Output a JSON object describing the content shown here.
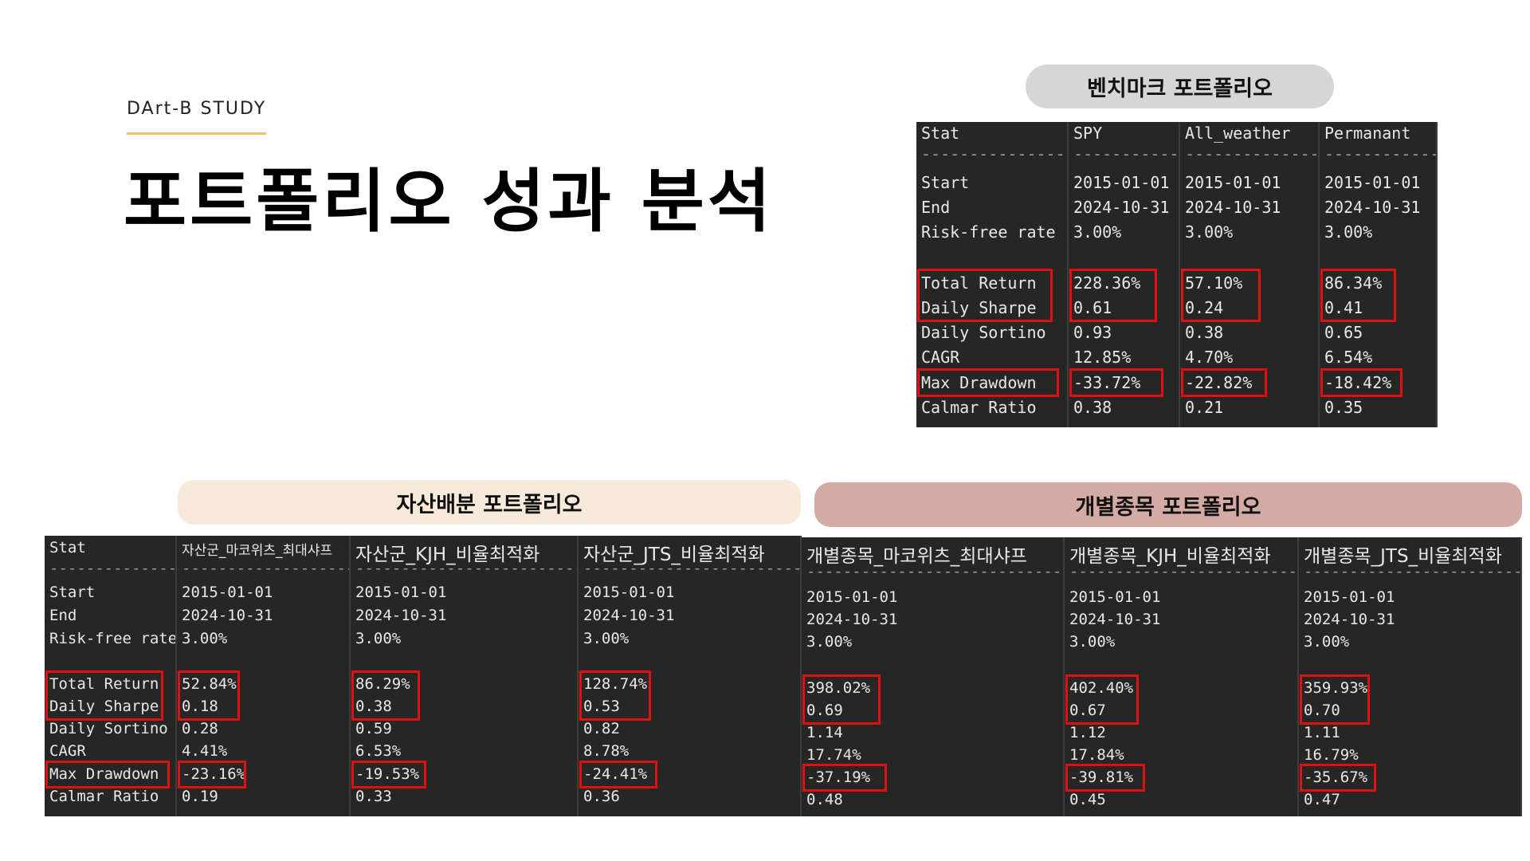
{
  "header": {
    "kicker": "DArt-B STUDY",
    "title": "포트폴리오 성과 분석"
  },
  "sections": {
    "benchmark": "벤치마크 포트폴리오",
    "asset_allocation": "자산배분 포트폴리오",
    "individual": "개별종목 포트폴리오"
  },
  "stat_labels": [
    "Start",
    "End",
    "Risk-free rate",
    "Total Return",
    "Daily Sharpe",
    "Daily Sortino",
    "CAGR",
    "Max Drawdown",
    "Calmar Ratio"
  ],
  "stat_header": "Stat",
  "benchmark_tables": [
    {
      "name": "SPY",
      "values": [
        "2015-01-01",
        "2024-10-31",
        "3.00%",
        "228.36%",
        "0.61",
        "0.93",
        "12.85%",
        "-33.72%",
        "0.38"
      ]
    },
    {
      "name": "All_weather",
      "values": [
        "2015-01-01",
        "2024-10-31",
        "3.00%",
        "57.10%",
        "0.24",
        "0.38",
        "4.70%",
        "-22.82%",
        "0.21"
      ]
    },
    {
      "name": "Permanant",
      "values": [
        "2015-01-01",
        "2024-10-31",
        "3.00%",
        "86.34%",
        "0.41",
        "0.65",
        "6.54%",
        "-18.42%",
        "0.35"
      ]
    }
  ],
  "asset_tables": [
    {
      "name": "자산군_마코위츠_최대샤프",
      "values": [
        "2015-01-01",
        "2024-10-31",
        "3.00%",
        "52.84%",
        "0.18",
        "0.28",
        "4.41%",
        "-23.16%",
        "0.19"
      ]
    },
    {
      "name": "자산군_KJH_비율최적화",
      "values": [
        "2015-01-01",
        "2024-10-31",
        "3.00%",
        "86.29%",
        "0.38",
        "0.59",
        "6.53%",
        "-19.53%",
        "0.33"
      ]
    },
    {
      "name": "자산군_JTS_비율최적화",
      "values": [
        "2015-01-01",
        "2024-10-31",
        "3.00%",
        "128.74%",
        "0.53",
        "0.82",
        "8.78%",
        "-24.41%",
        "0.36"
      ]
    }
  ],
  "individual_tables": [
    {
      "name": "개별종목_마코위츠_최대샤프",
      "values": [
        "2015-01-01",
        "2024-10-31",
        "3.00%",
        "398.02%",
        "0.69",
        "1.14",
        "17.74%",
        "-37.19%",
        "0.48"
      ]
    },
    {
      "name": "개별종목_KJH_비율최적화",
      "values": [
        "2015-01-01",
        "2024-10-31",
        "3.00%",
        "402.40%",
        "0.67",
        "1.12",
        "17.84%",
        "-39.81%",
        "0.45"
      ]
    },
    {
      "name": "개별종목_JTS_비율최적화",
      "values": [
        "2015-01-01",
        "2024-10-31",
        "3.00%",
        "359.93%",
        "0.70",
        "1.11",
        "16.79%",
        "-35.67%",
        "0.47"
      ]
    }
  ],
  "colors": {
    "highlight": "#e01010",
    "terminal_bg": "#262626",
    "accent_line": "#e7c36a"
  }
}
